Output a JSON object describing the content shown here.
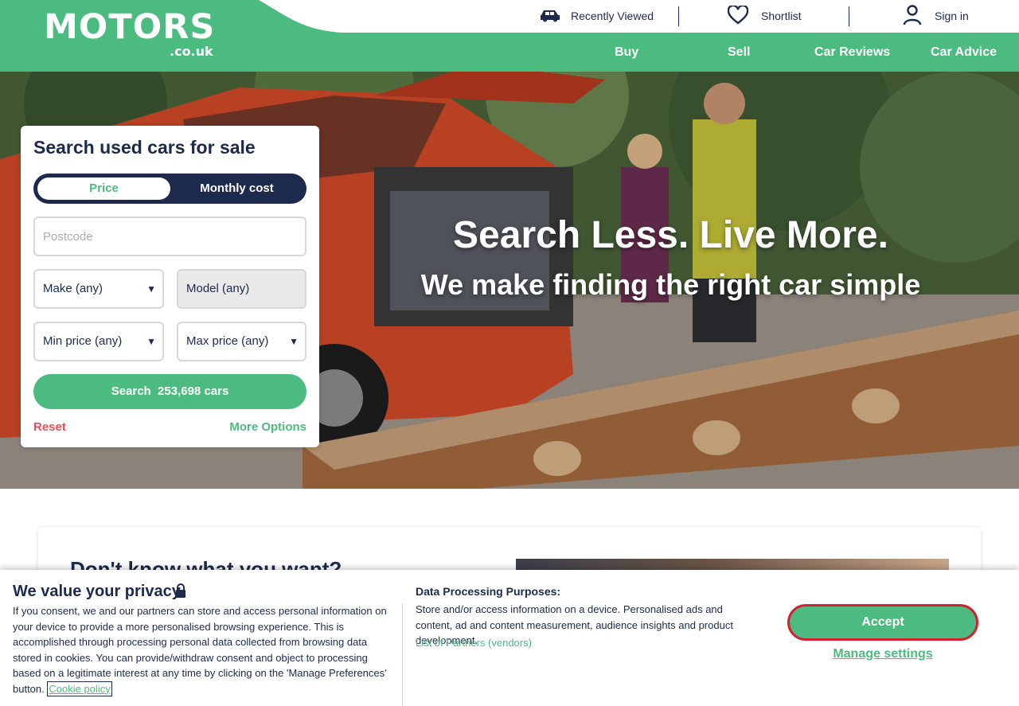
{
  "header": {
    "logo": {
      "main": "MOTORS",
      "sub": ".co.uk"
    },
    "utility": {
      "recently_viewed": "Recently Viewed",
      "shortlist": "Shortlist",
      "sign_in": "Sign in"
    },
    "nav": [
      "Buy",
      "Sell",
      "Car Reviews",
      "Car Advice"
    ]
  },
  "hero": {
    "headline": "Search Less. Live More.",
    "subheadline": "We make finding the right car simple"
  },
  "search_panel": {
    "title": "Search used cars for sale",
    "toggle": {
      "selected": "Price",
      "other": "Monthly cost"
    },
    "postcode_placeholder": "Postcode",
    "make": "Make (any)",
    "model": "Model (any)",
    "min_price": "Min price (any)",
    "max_price": "Max price (any)",
    "caret": "▼",
    "search_button": "Search  253,698 cars",
    "reset": "Reset",
    "more_options": "More Options"
  },
  "promo_card": {
    "title": "Don't know what you want?"
  },
  "consent": {
    "title": "We value your privacy",
    "body": "If you consent, we and our partners can store and access personal information on your device to provide a more personalised browsing experience. This is accomplished through processing personal data collected from browsing data stored in cookies. You can provide/withdraw consent and object to processing based on a legitimate interest at any time by clicking on the 'Manage Preferences' button.",
    "cookie_policy": "Cookie policy",
    "purposes_title": "Data Processing Purposes:",
    "purposes_text": "Store and/or access information on a device. Personalised ads and content, ad and content measurement, audience insights and product development.",
    "partners_link": "List of Partners (vendors)",
    "accept": "Accept",
    "manage": "Manage settings"
  },
  "colors": {
    "brand_green": "#4cbb7f",
    "navy": "#1d2a4d",
    "reset_red": "#e8505b",
    "focus_red": "#d61f2f"
  }
}
